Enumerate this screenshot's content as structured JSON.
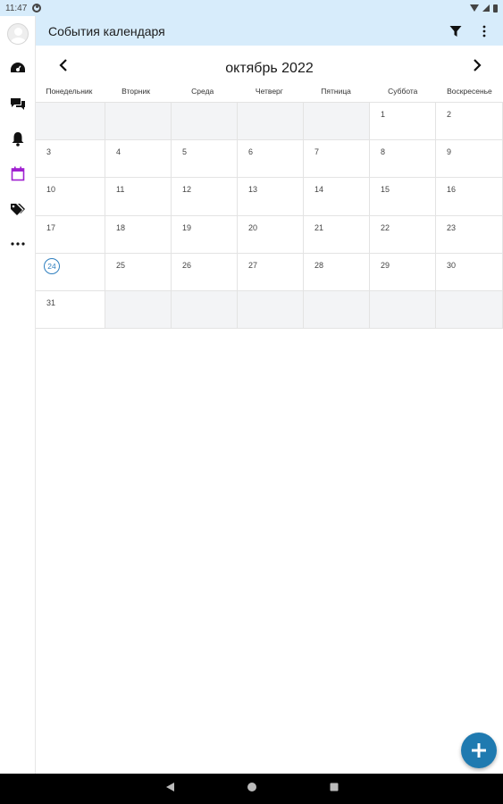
{
  "status_bar": {
    "time": "11:47"
  },
  "app_bar": {
    "title": "События календаря",
    "icons": [
      "filter-icon",
      "more-vert-icon"
    ]
  },
  "rail": {
    "items": [
      "avatar",
      "dashboard-icon",
      "chat-icon",
      "bell-icon",
      "calendar-icon",
      "tags-icon",
      "more-horiz-icon"
    ],
    "active": "calendar-icon",
    "active_color": "#a020d0"
  },
  "calendar": {
    "month_title": "октябрь 2022",
    "weekdays": [
      "Понедельник",
      "Вторник",
      "Среда",
      "Четверг",
      "Пятница",
      "Суббота",
      "Воскресенье"
    ],
    "weeks": [
      [
        "",
        "",
        "",
        "",
        "",
        "1",
        "2"
      ],
      [
        "3",
        "4",
        "5",
        "6",
        "7",
        "8",
        "9"
      ],
      [
        "10",
        "11",
        "12",
        "13",
        "14",
        "15",
        "16"
      ],
      [
        "17",
        "18",
        "19",
        "20",
        "21",
        "22",
        "23"
      ],
      [
        "24",
        "25",
        "26",
        "27",
        "28",
        "29",
        "30"
      ],
      [
        "31",
        "",
        "",
        "",
        "",
        "",
        ""
      ]
    ],
    "today": "24"
  },
  "colors": {
    "header_bg": "#d7ecfb",
    "fab": "#1f7ab0",
    "today_ring": "#2f7fbf",
    "empty_cell": "#f3f4f6"
  }
}
